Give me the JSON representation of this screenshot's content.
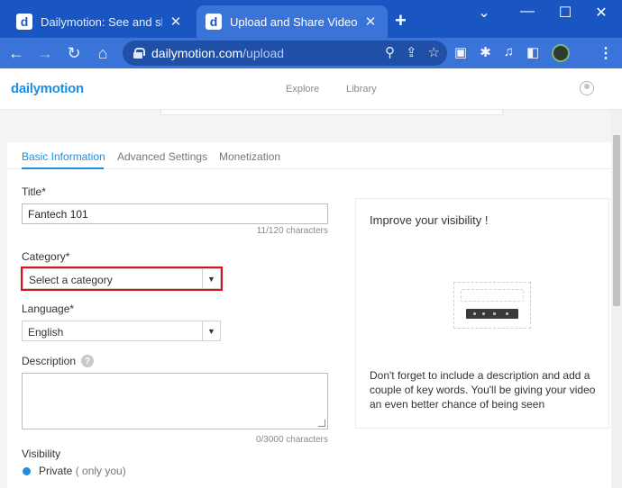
{
  "browser": {
    "tabs": [
      {
        "title": "Dailymotion: See and share the",
        "favicon": "d"
      },
      {
        "title": "Upload and Share Videos | D",
        "favicon": "d"
      }
    ],
    "new_tab": "+",
    "window_controls": {
      "collapse": "⌄",
      "minimize": "—",
      "maximize": "☐",
      "close": "✕"
    },
    "url_host": "dailymotion.com",
    "url_path": "/upload"
  },
  "header": {
    "logo": "dailymotion",
    "nav": [
      "Explore",
      "Library"
    ]
  },
  "tabs": [
    "Basic Information",
    "Advanced Settings",
    "Monetization"
  ],
  "form": {
    "title_label": "Title*",
    "title_value": "Fantech 101",
    "title_count": "11/120 characters",
    "category_label": "Category*",
    "category_value": "Select a category",
    "language_label": "Language*",
    "language_value": "English",
    "description_label": "Description",
    "description_help": "?",
    "description_count": "0/3000 characters",
    "visibility_label": "Visibility",
    "visibility_option": "Private",
    "visibility_note": "( only you)"
  },
  "sidebar": {
    "title": "Improve your visibility !",
    "text": "Don't forget to include a description and add a couple of key words. You'll be giving your video an even better chance of being seen"
  },
  "colors": {
    "brand": "#1c8fe0",
    "chrome": "#1a56c2",
    "highlight": "#d4141c"
  }
}
